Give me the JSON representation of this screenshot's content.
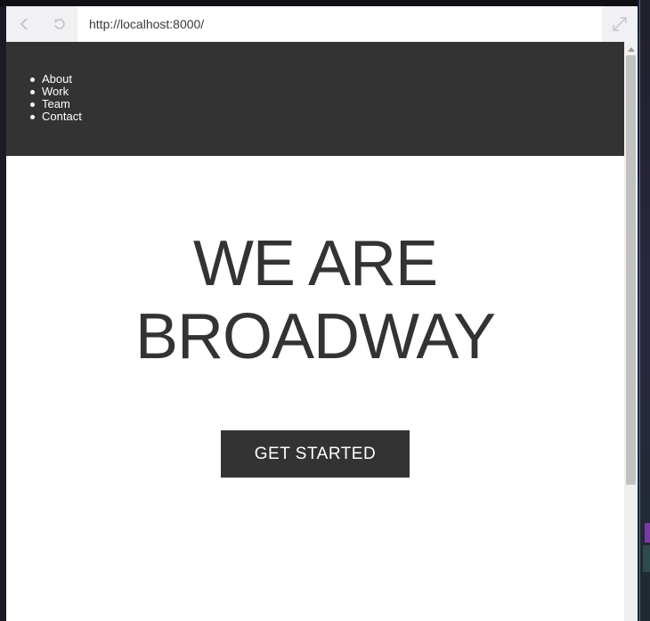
{
  "browser": {
    "url": "http://localhost:8000/",
    "icons": {
      "back": "back-arrow-icon",
      "reload": "reload-icon",
      "expand": "expand-icon"
    }
  },
  "page": {
    "nav": {
      "items": [
        {
          "label": "About"
        },
        {
          "label": "Work"
        },
        {
          "label": "Team"
        },
        {
          "label": "Contact"
        }
      ]
    },
    "hero": {
      "title_line1": "WE ARE",
      "title_line2": "BROADWAY",
      "cta_label": "GET STARTED"
    }
  },
  "colors": {
    "header_bg": "#333333",
    "text_dark": "#333333",
    "button_bg": "#333333",
    "button_text": "#ffffff",
    "toolbar_bg": "#f1f1f3"
  }
}
